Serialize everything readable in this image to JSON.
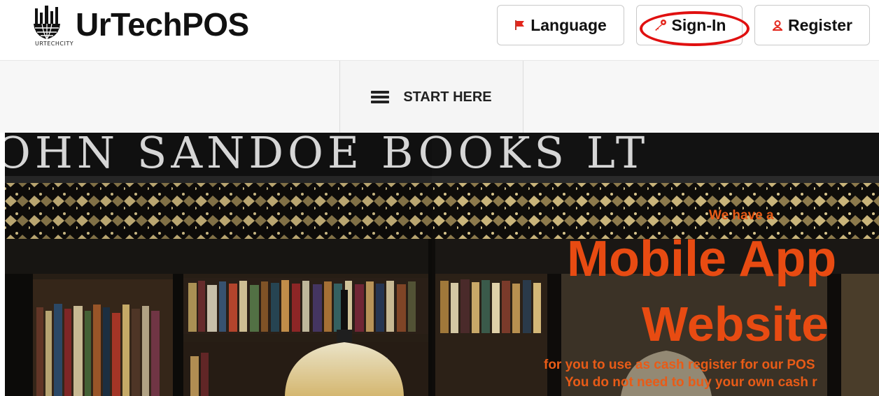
{
  "brand": {
    "name": "UrTechPOS",
    "logo_caption": "URTECHCITY"
  },
  "header": {
    "language_label": "Language",
    "signin_label": "Sign-In",
    "register_label": "Register",
    "icons": {
      "language": "flag-icon",
      "signin": "key-icon",
      "register": "user-icon"
    },
    "highlight_color": "#e01010"
  },
  "nav": {
    "start_label": "START HERE"
  },
  "hero": {
    "sign_text": "OHN SANDOE BOOKS LT",
    "tagline_small": "We have a",
    "headline_1": "Mobile App",
    "headline_2": "Website",
    "line_1": "for you to use as cash register for our POS",
    "line_2": "You do not need to buy your own cash r",
    "accent_color": "#e84b12"
  }
}
